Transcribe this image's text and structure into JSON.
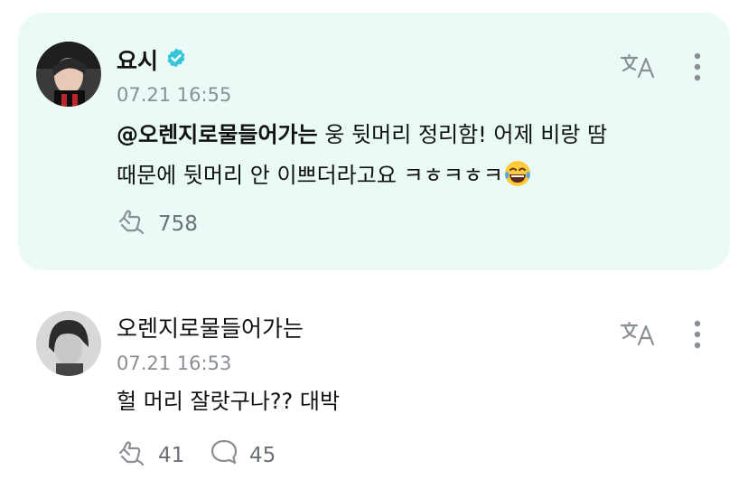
{
  "posts": [
    {
      "author": "요시",
      "verified": true,
      "timestamp": "07.21 16:55",
      "mention": "@오렌지로물들어가는",
      "text_line1": " 웅 뒷머리 정리함! 어제 비랑 땀",
      "text_line2": "때문에 뒷머리 안 이쁘더라고요 ㅋㅎㅋㅎㅋ",
      "emoji": "laughing-tears",
      "like_count": "758",
      "highlighted": true,
      "highlight_color": "#e9faf7"
    },
    {
      "author": "오렌지로물들어가는",
      "timestamp": "07.21 16:53",
      "text": "헐 머리 잘랏구나?? 대박",
      "like_count": "41",
      "comment_count": "45"
    }
  ],
  "colors": {
    "verified_badge": "#35c6d9",
    "muted_text": "#8a8f95",
    "icon": "#8a8f95"
  },
  "icons": [
    "verified-badge-icon",
    "translate-icon",
    "more-vertical-icon",
    "like-icon",
    "comment-icon"
  ]
}
